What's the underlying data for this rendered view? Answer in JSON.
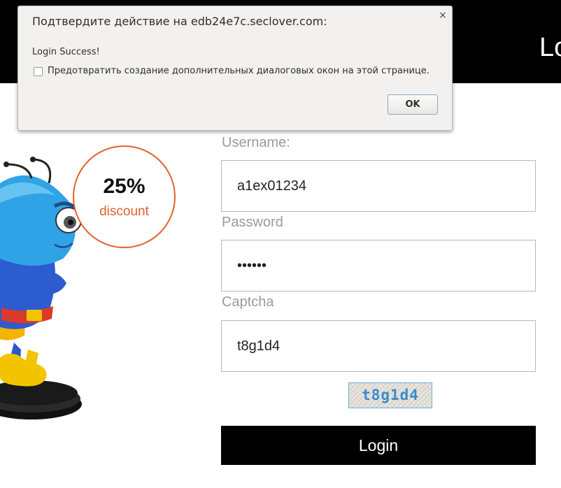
{
  "header": {
    "title": "Lo"
  },
  "promo": {
    "discount_value": "25%",
    "discount_label": "discount"
  },
  "form": {
    "username_label": "Username:",
    "username_value": "a1ex01234",
    "password_label": "Password",
    "password_value": "••••••",
    "captcha_label": "Captcha",
    "captcha_value": "t8g1d4",
    "captcha_image_text": "t8g1d4",
    "login_label": "Login"
  },
  "dialog": {
    "title": "Подтвердите действие на edb24e7c.seclover.com:",
    "message": "Login Success!",
    "checkbox_label": "Предотвратить создание дополнительных диалоговых окон на этой странице.",
    "checkbox_checked": false,
    "ok_label": "OK",
    "close_symbol": "×"
  },
  "colors": {
    "accent": "#e0622a",
    "header_bg": "#000000",
    "button_bg": "#000000",
    "captcha_text": "#3a8ad0"
  },
  "icons": {
    "mascot": "ant-superhero-mascot",
    "close": "close-icon",
    "checkbox": "checkbox-icon"
  }
}
